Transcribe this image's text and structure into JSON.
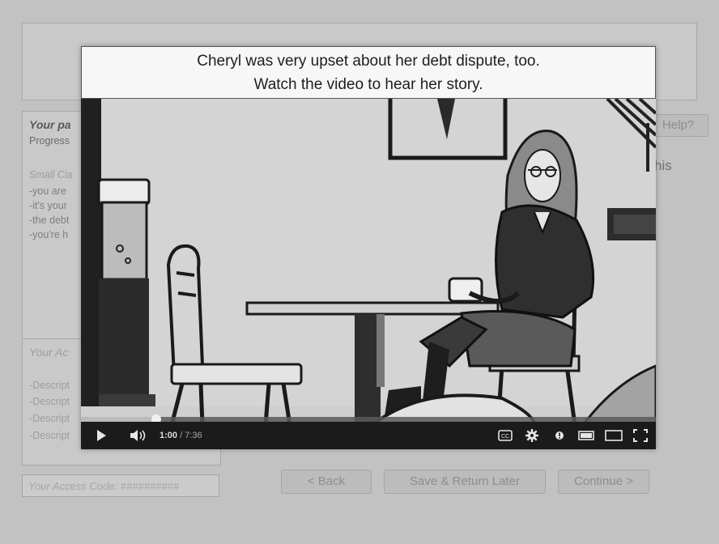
{
  "background": {
    "left_panel": {
      "title": "Your pa",
      "progress": "Progress",
      "subtitle": "Small Cla",
      "lines": [
        "-you are",
        "-it's your",
        "-the debt",
        "-you're h"
      ]
    },
    "accounts_panel": {
      "title": "Your Ac",
      "items": [
        "-Descript",
        "-Descript",
        "-Descript",
        "-Descript"
      ]
    },
    "access_code_placeholder": "Your Access Code: ##########",
    "help_label": "Help?",
    "right_text": "his",
    "nav": {
      "back": "< Back",
      "save": "Save & Return Later",
      "continue": "Continue >"
    }
  },
  "modal": {
    "caption_line1": "Cheryl was very upset about her debt dispute, too.",
    "caption_line2": "Watch the video to hear her story."
  },
  "player": {
    "current_time": "1:00",
    "duration": "/ 7:36",
    "progress_fraction": 0.1316,
    "icons": [
      "play-icon",
      "volume-icon",
      "captions-icon",
      "settings-icon",
      "annotations-icon",
      "small-player-icon",
      "theater-mode-icon",
      "fullscreen-icon"
    ]
  },
  "colors": {
    "overlay_bg": "#c2c2c2",
    "control_bar": "#1b1b1b",
    "caption_bg": "#f7f7f7"
  }
}
